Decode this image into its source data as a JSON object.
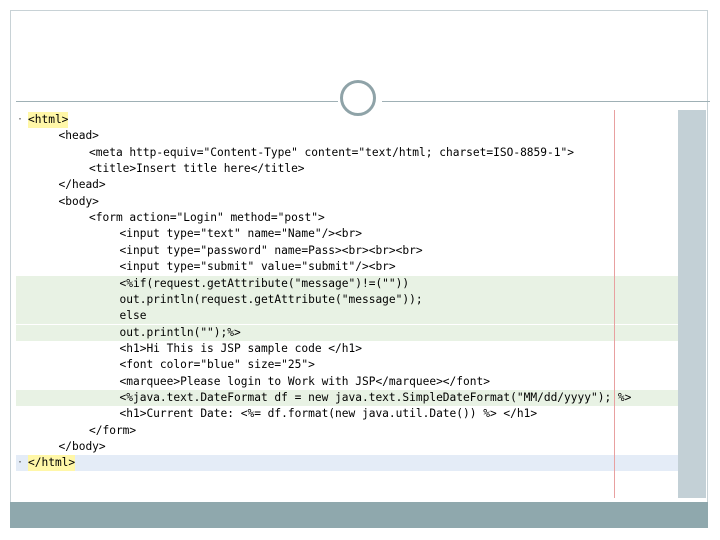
{
  "editor": {
    "lines": [
      {
        "indent": 0,
        "text": "<html>",
        "fold": "-",
        "style": "tag-box"
      },
      {
        "indent": 1,
        "text": "<head>"
      },
      {
        "indent": 2,
        "text": "<meta http-equiv=\"Content-Type\" content=\"text/html; charset=ISO-8859-1\">"
      },
      {
        "indent": 2,
        "text": "<title>Insert title here</title>"
      },
      {
        "indent": 1,
        "text": "</head>"
      },
      {
        "indent": 1,
        "text": "<body>"
      },
      {
        "indent": 2,
        "text": "<form action=\"Login\" method=\"post\">"
      },
      {
        "indent": 3,
        "text": "<input type=\"text\" name=\"Name\"/><br>"
      },
      {
        "indent": 3,
        "text": "<input type=\"password\" name=Pass><br><br><br>"
      },
      {
        "indent": 3,
        "text": "<input type=\"submit\" value=\"submit\"/><br>"
      },
      {
        "indent": 3,
        "text": "<%if(request.getAttribute(\"message\")!=(\"\"))",
        "style": "hl"
      },
      {
        "indent": 3,
        "text": "out.println(request.getAttribute(\"message\"));",
        "style": "hl"
      },
      {
        "indent": 3,
        "text": "else",
        "style": "hl"
      },
      {
        "indent": 3,
        "text": "out.println(\"\");%>",
        "style": "hl"
      },
      {
        "indent": 3,
        "text": "<h1>Hi This is JSP sample code </h1>"
      },
      {
        "indent": 3,
        "text": "<font color=\"blue\" size=\"25\">"
      },
      {
        "indent": 3,
        "text": "<marquee>Please login to Work with JSP</marquee></font>"
      },
      {
        "indent": 3,
        "text": "<%java.text.DateFormat df = new java.text.SimpleDateFormat(\"MM/dd/yyyy\"); %>",
        "style": "hl"
      },
      {
        "indent": 3,
        "text": "<h1>Current Date: <%= df.format(new java.util.Date()) %> </h1>"
      },
      {
        "indent": 2,
        "text": "</form>"
      },
      {
        "indent": 1,
        "text": "</body>"
      },
      {
        "indent": 0,
        "text": "</html>",
        "fold": "-",
        "style": "tag-box",
        "caret": true
      }
    ]
  }
}
